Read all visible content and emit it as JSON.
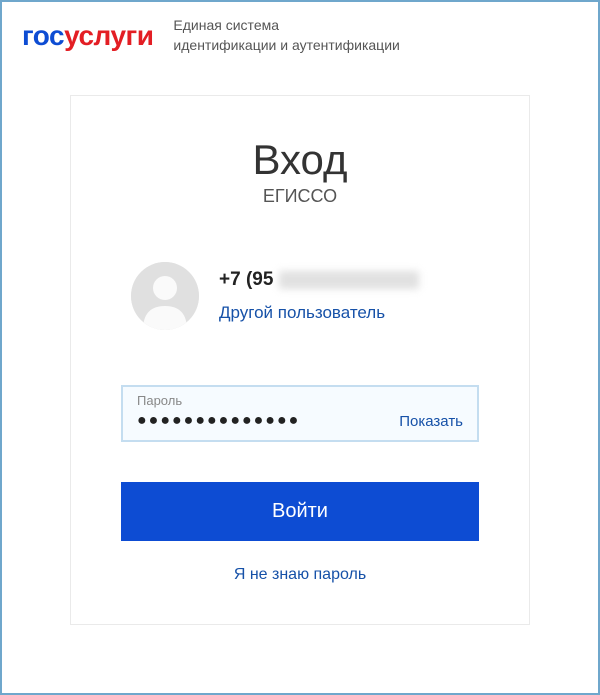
{
  "header": {
    "logo_part1": "гос",
    "logo_part2": "услуги",
    "tagline_line1": "Единая система",
    "tagline_line2": "идентификации и аутентификации"
  },
  "card": {
    "title": "Вход",
    "subtitle": "ЕГИССО",
    "phone_prefix": "+7 (95",
    "other_user": "Другой пользователь",
    "password_label": "Пароль",
    "password_value": "●●●●●●●●●●●●●●",
    "show_password": "Показать",
    "login_button": "Войти",
    "forgot_password": "Я не знаю пароль"
  }
}
